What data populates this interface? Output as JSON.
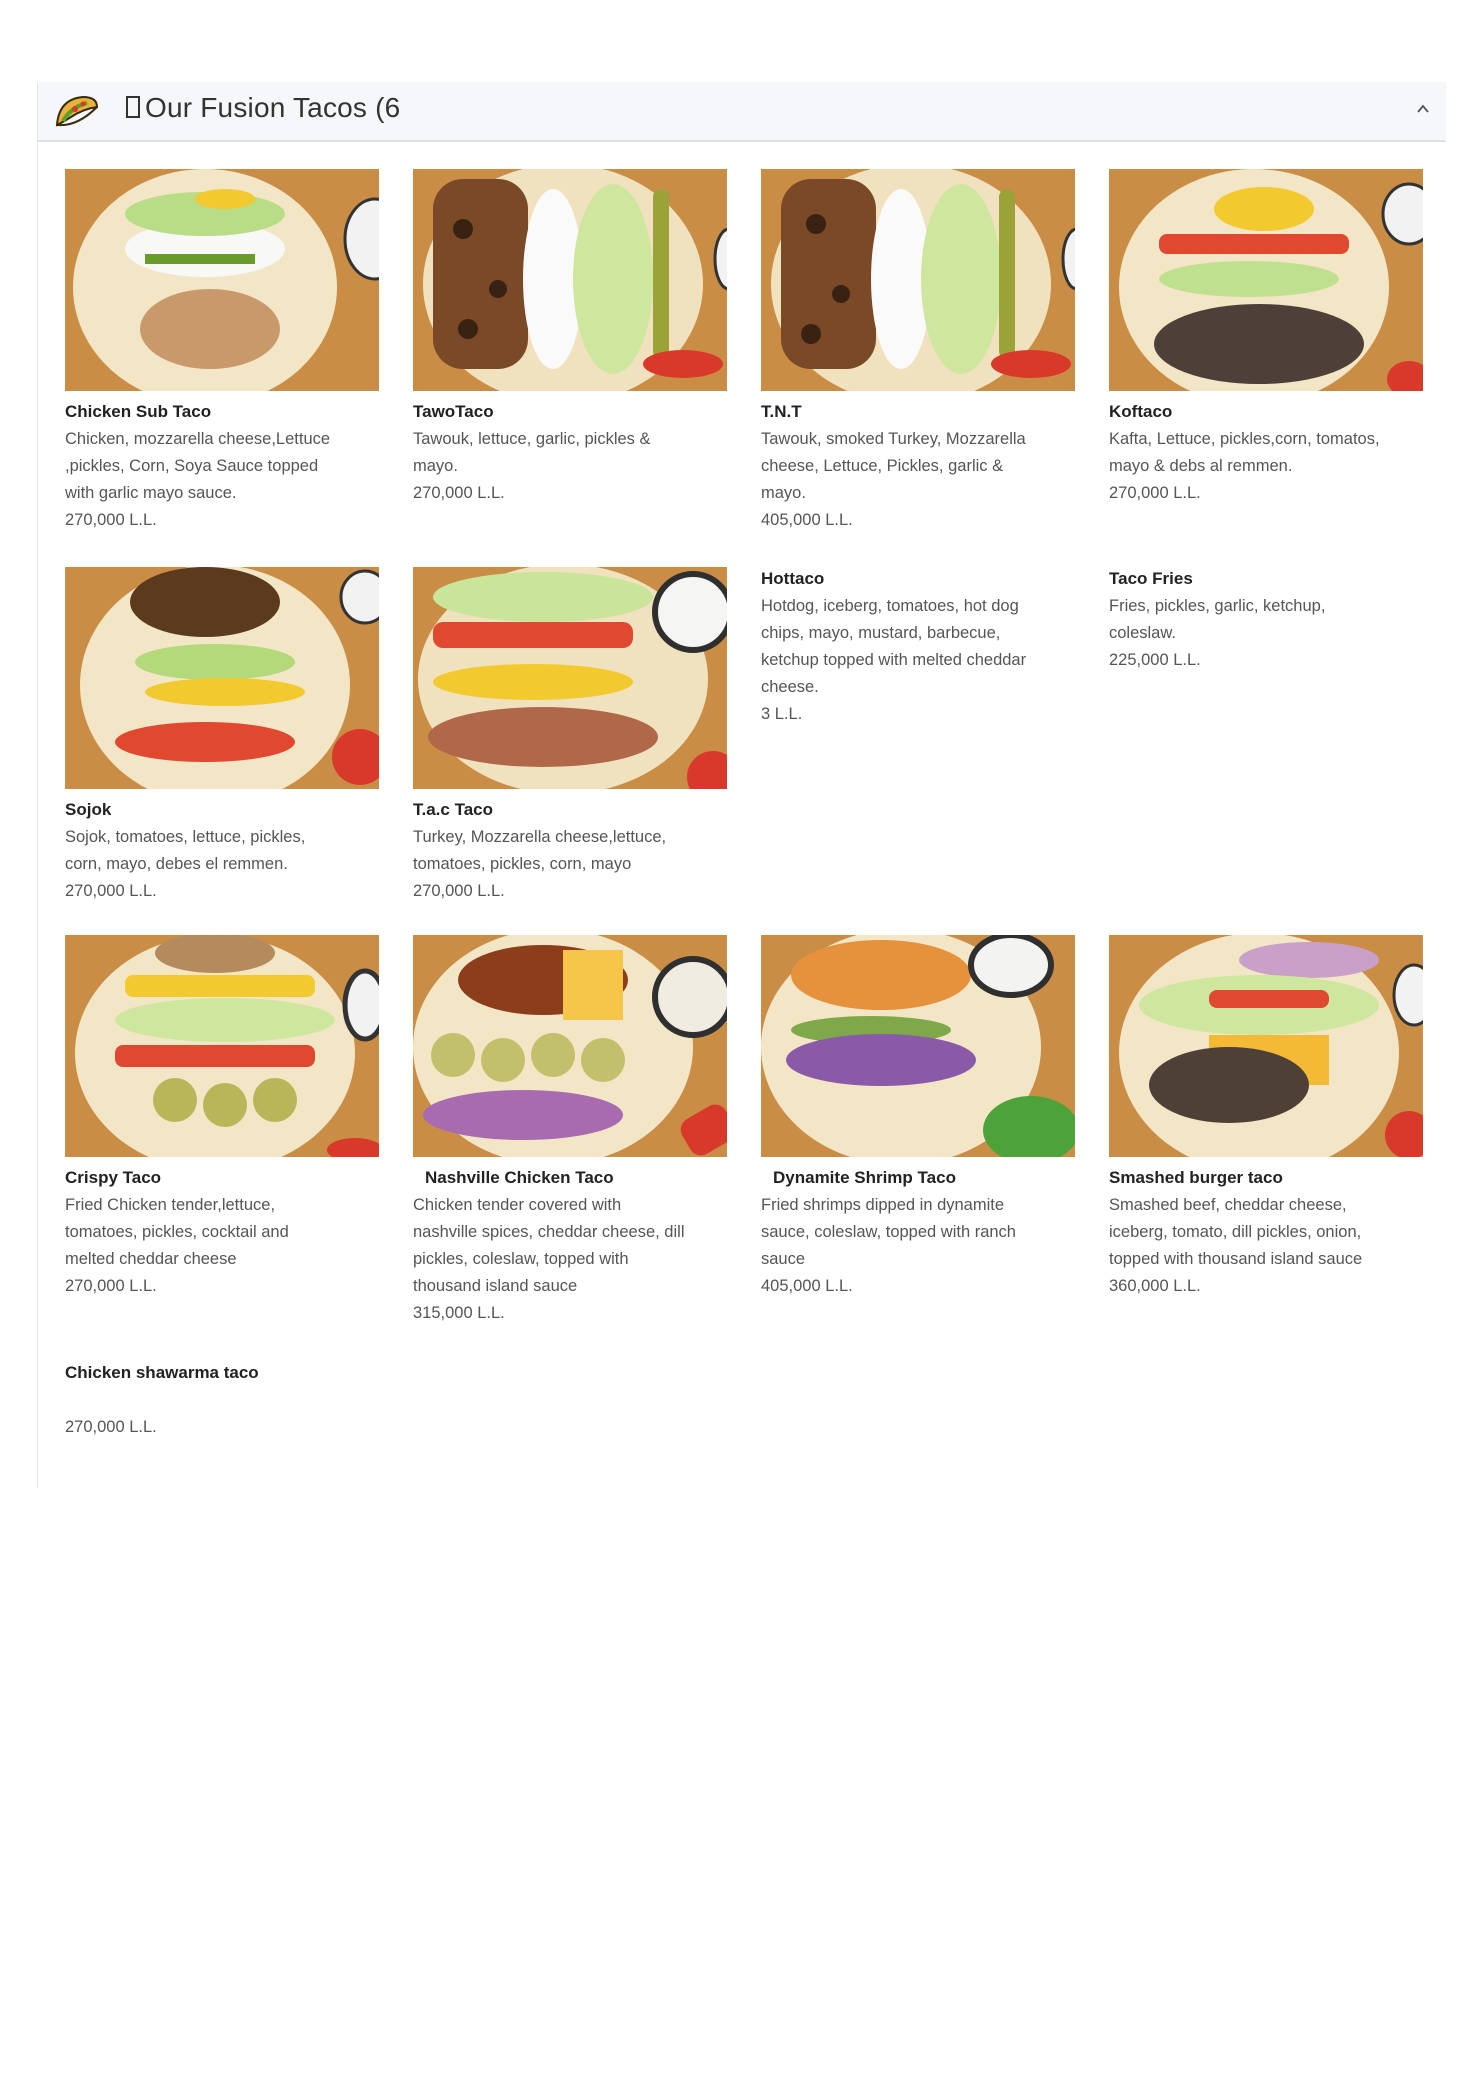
{
  "section": {
    "title": "Our Fusion Tacos (6",
    "icon": "taco-icon",
    "toggle_icon": "chevron-up-icon"
  },
  "currency_colors": {
    "accent": "#f4f6f9"
  },
  "items": [
    {
      "name": "Chicken Sub Taco",
      "desc": [
        "Chicken, mozzarella cheese,Lettuce",
        ",pickles, Corn, Soya Sauce topped",
        "with garlic mayo sauce."
      ],
      "price": "270,000 L.L."
    },
    {
      "name": "TawoTaco",
      "desc": [
        "Tawouk, lettuce, garlic, pickles &",
        "mayo."
      ],
      "price": "270,000 L.L."
    },
    {
      "name": "T.N.T",
      "desc": [
        "Tawouk, smoked Turkey, Mozzarella",
        "cheese, Lettuce, Pickles, garlic &",
        "mayo."
      ],
      "price": "405,000 L.L."
    },
    {
      "name": "Koftaco",
      "desc": [
        "Kafta, Lettuce, pickles,corn, tomatos,",
        "mayo & debs al remmen."
      ],
      "price": "270,000 L.L."
    },
    {
      "name": "Sojok",
      "desc": [
        "Sojok, tomatoes, lettuce, pickles,",
        "corn, mayo, debes el remmen."
      ],
      "price": "270,000 L.L."
    },
    {
      "name": "T.a.c Taco",
      "desc": [
        "Turkey, Mozzarella cheese,lettuce,",
        "tomatoes, pickles, corn, mayo"
      ],
      "price": "270,000 L.L."
    },
    {
      "name": "Hottaco",
      "desc": [
        "Hotdog, iceberg, tomatoes, hot dog",
        "chips, mayo, mustard, barbecue,",
        "ketchup topped with melted cheddar",
        "cheese."
      ],
      "price": "3 L.L."
    },
    {
      "name": "Taco Fries",
      "desc": [
        "Fries, pickles, garlic, ketchup,",
        "coleslaw."
      ],
      "price": "225,000 L.L."
    },
    {
      "name": "Crispy Taco",
      "desc": [
        "Fried Chicken tender,lettuce,",
        "tomatoes, pickles, cocktail and",
        "melted cheddar cheese"
      ],
      "price": "270,000 L.L."
    },
    {
      "name": "Nashville Chicken Taco",
      "desc": [
        "Chicken tender covered with",
        "nashville spices, cheddar cheese, dill",
        "pickles, coleslaw, topped with",
        "thousand island sauce"
      ],
      "price": "315,000 L.L."
    },
    {
      "name": "Dynamite Shrimp Taco",
      "desc": [
        "Fried shrimps dipped in dynamite",
        "sauce, coleslaw, topped with ranch",
        "sauce"
      ],
      "price": "405,000 L.L."
    },
    {
      "name": "Smashed burger taco",
      "desc": [
        "Smashed beef, cheddar cheese,",
        "iceberg, tomato, dill pickles, onion,",
        "topped with thousand island sauce"
      ],
      "price": "360,000 L.L."
    },
    {
      "name": "Chicken shawarma taco",
      "desc": [
        ""
      ],
      "price": "270,000 L.L."
    }
  ]
}
